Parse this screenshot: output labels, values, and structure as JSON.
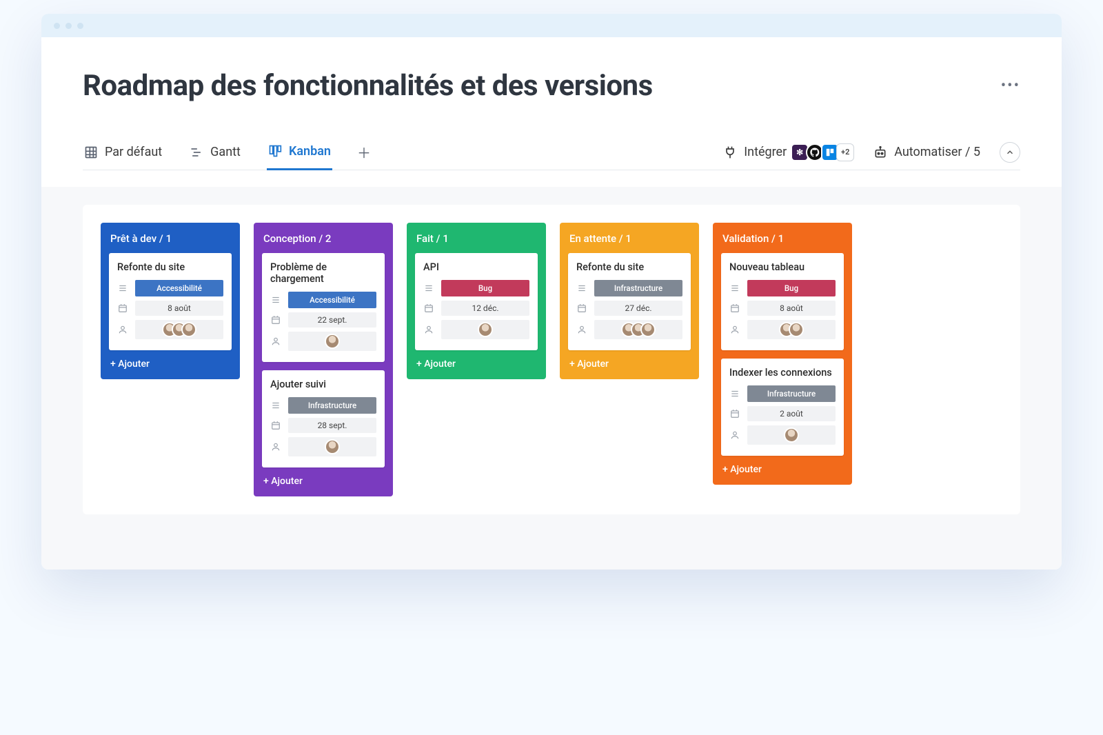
{
  "header": {
    "title": "Roadmap des fonctionnalités et des versions"
  },
  "toolbar": {
    "views": [
      {
        "label": "Par défaut",
        "icon": "grid"
      },
      {
        "label": "Gantt",
        "icon": "gantt"
      },
      {
        "label": "Kanban",
        "icon": "kanban",
        "active": true
      }
    ],
    "integrate_label": "Intégrer",
    "integrations_more": "+2",
    "automate_label": "Automatiser / 5"
  },
  "board": {
    "add_label": "+ Ajouter",
    "columns": [
      {
        "title": "Prêt à dev / 1",
        "color": "c-blue",
        "cards": [
          {
            "title": "Refonte du site",
            "tag": {
              "label": "Accessibilité",
              "color": "blue"
            },
            "date": "8 août",
            "avatars": 3
          }
        ]
      },
      {
        "title": "Conception / 2",
        "color": "c-purple",
        "cards": [
          {
            "title": "Problème de chargement",
            "tag": {
              "label": "Accessibilité",
              "color": "blue"
            },
            "date": "22 sept.",
            "avatars": 1
          },
          {
            "title": "Ajouter suivi",
            "tag": {
              "label": "Infrastructure",
              "color": "gray"
            },
            "date": "28 sept.",
            "avatars": 1
          }
        ]
      },
      {
        "title": "Fait / 1",
        "color": "c-green",
        "cards": [
          {
            "title": "API",
            "tag": {
              "label": "Bug",
              "color": "red"
            },
            "date": "12 déc.",
            "avatars": 1
          }
        ]
      },
      {
        "title": "En attente / 1",
        "color": "c-orange",
        "cards": [
          {
            "title": "Refonte du site",
            "tag": {
              "label": "Infrastructure",
              "color": "gray"
            },
            "date": "27 déc.",
            "avatars": 3
          }
        ]
      },
      {
        "title": "Validation / 1",
        "color": "c-deep",
        "cards": [
          {
            "title": "Nouveau tableau",
            "tag": {
              "label": "Bug",
              "color": "red"
            },
            "date": "8 août",
            "avatars": 2
          },
          {
            "title": "Indexer les connexions",
            "tag": {
              "label": "Infrastructure",
              "color": "gray"
            },
            "date": "2 août",
            "avatars": 1
          }
        ]
      }
    ]
  }
}
